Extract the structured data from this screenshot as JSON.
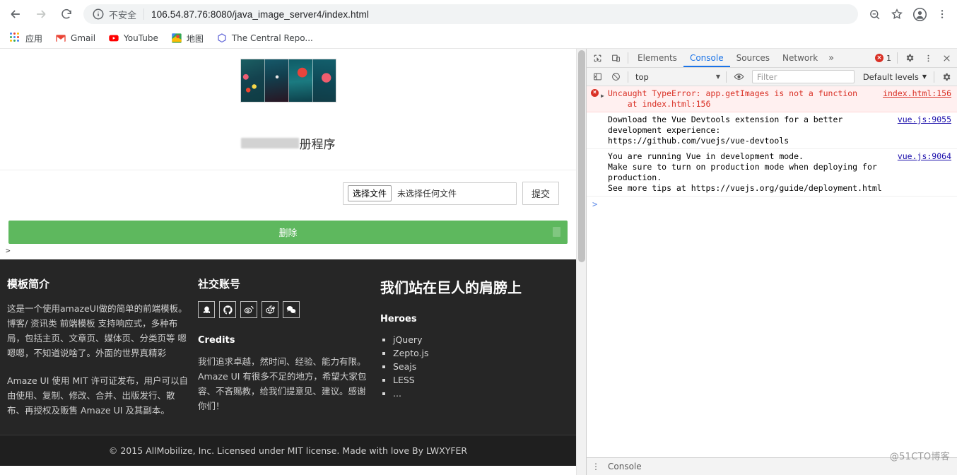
{
  "browser": {
    "nav": {
      "back_icon": "arrow-left-icon",
      "forward_icon": "arrow-right-icon",
      "reload_icon": "reload-icon"
    },
    "omnibox": {
      "info_icon": "info-circle-icon",
      "security_label": "不安全",
      "url": "106.54.87.76:8080/java_image_server4/index.html"
    },
    "toolbar_icons": [
      "zoom-out-icon",
      "star-icon",
      "profile-avatar-icon",
      "kebab-menu-icon"
    ],
    "bookmarks": [
      {
        "label": "应用",
        "icon": "apps-grid-icon"
      },
      {
        "label": "Gmail",
        "icon": "gmail-icon"
      },
      {
        "label": "YouTube",
        "icon": "youtube-icon"
      },
      {
        "label": "地图",
        "icon": "google-maps-icon"
      },
      {
        "label": "The Central Repo...",
        "icon": "maven-icon"
      }
    ]
  },
  "page": {
    "title_prefix_redacted": "",
    "title_suffix": "册程序",
    "thumbnail_alt": "image-strip-thumbnail",
    "upload": {
      "choose_file_label": "选择文件",
      "no_file_label": "未选择任何文件",
      "submit_label": "提交"
    },
    "delete_button_label": "删除",
    "console_caret": ">",
    "footer": {
      "col_template": {
        "heading": "模板简介",
        "paragraph1": "这是一个使用amazeUI做的简单的前端模板。\n博客/ 资讯类 前端模板\n支持响应式，多种布局，包括主页、文章页、媒体页、分类页等\n嗯嗯嗯，不知道说啥了。外面的世界真精彩",
        "paragraph2": "Amaze UI 使用 MIT 许可证发布，用户可以自由使用、复制、修改、合并、出版发行、散布、再授权及贩售 Amaze UI 及其副本。"
      },
      "col_social": {
        "heading": "社交账号",
        "icons": [
          "qq-icon",
          "github-icon",
          "weibo-icon",
          "reddit-icon",
          "wechat-icon"
        ],
        "credits_heading": "Credits",
        "credits_text": "我们追求卓越，然时间、经验、能力有限。Amaze UI 有很多不足的地方，希望大家包容、不吝赐教，给我们提意见、建议。感谢你们！"
      },
      "col_heroes": {
        "heading": "我们站在巨人的肩膀上",
        "subheading": "Heroes",
        "items": [
          "jQuery",
          "Zepto.js",
          "Seajs",
          "LESS",
          "..."
        ]
      },
      "copyright": "© 2015 AllMobilize, Inc. Licensed under MIT license. Made with love By LWXYFER"
    }
  },
  "devtools": {
    "toolbar": {
      "inspect_icon": "inspect-element-icon",
      "device_icon": "device-toolbar-icon",
      "tabs": [
        {
          "label": "Elements",
          "active": false
        },
        {
          "label": "Console",
          "active": true
        },
        {
          "label": "Sources",
          "active": false
        },
        {
          "label": "Network",
          "active": false
        }
      ],
      "more_tabs_label": "»",
      "error_count": "1",
      "settings_icon": "gear-icon",
      "menu_icon": "kebab-menu-icon",
      "close_icon": "close-icon"
    },
    "filterbar": {
      "sidebar_icon": "console-sidebar-icon",
      "clear_icon": "clear-console-icon",
      "context": "top",
      "eye_icon": "live-expression-eye-icon",
      "filter_placeholder": "Filter",
      "levels": "Default levels",
      "settings_icon": "gear-icon"
    },
    "messages": [
      {
        "type": "error",
        "arrow": "▶",
        "text": "Uncaught TypeError: app.getImages is not a function\n    at index.html:156",
        "link_in_text": "index.html:156",
        "source": "index.html:156"
      },
      {
        "type": "info",
        "text": "Download the Vue Devtools extension for a better\ndevelopment experience:\nhttps://github.com/vuejs/vue-devtools",
        "link_in_text": "https://github.com/vuejs/vue-devtools",
        "source": "vue.js:9055"
      },
      {
        "type": "info",
        "text": "You are running Vue in development mode.\nMake sure to turn on production mode when deploying for production.\nSee more tips at https://vuejs.org/guide/deployment.html",
        "link_in_text": "https://vuejs.org/guide/deployment.html",
        "source": "vue.js:9064"
      }
    ],
    "prompt_symbol": ">",
    "drawer_tab": "Console"
  },
  "watermark": "@51CTO博客",
  "colors": {
    "accent_blue": "#1a73e8",
    "error_red": "#d93025",
    "delete_green": "#5eb85e",
    "footer_dark": "#262626"
  }
}
